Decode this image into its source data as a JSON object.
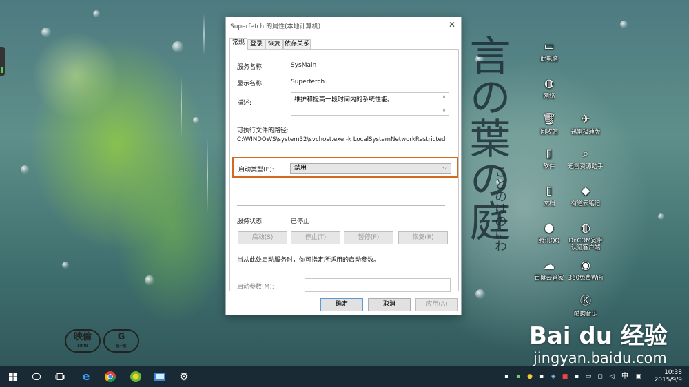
{
  "dialog": {
    "title": "Superfetch 的属性(本地计算机)",
    "close_glyph": "✕",
    "tabs": [
      "常规",
      "登录",
      "恢复",
      "依存关系"
    ],
    "service_name_label": "服务名称:",
    "service_name": "SysMain",
    "display_name_label": "显示名称:",
    "display_name": "Superfetch",
    "description_label": "描述:",
    "description": "维护和提高一段时间内的系统性能。",
    "exe_path_label": "可执行文件的路径:",
    "exe_path": "C:\\WINDOWS\\system32\\svchost.exe -k LocalSystemNetworkRestricted",
    "startup_type_label": "启动类型(E):",
    "startup_type_value": "禁用",
    "service_status_label": "服务状态:",
    "service_status": "已停止",
    "btn_start": "启动(S)",
    "btn_stop": "停止(T)",
    "btn_pause": "暂停(P)",
    "btn_resume": "恢复(R)",
    "hint": "当从此处启动服务时，你可指定所适用的启动参数。",
    "start_params_label": "启动参数(M):",
    "start_params_value": "",
    "btn_ok": "确定",
    "btn_cancel": "取消",
    "btn_apply": "应用(A)",
    "highlight_color": "#d36a1f"
  },
  "desktop_icons": [
    {
      "label": "此电脑",
      "icon": "monitor-icon",
      "glyph": "▭"
    },
    {
      "label": "网络",
      "icon": "globe-icon",
      "glyph": "◍"
    },
    {
      "label": "回收站",
      "icon": "recycle-bin-icon",
      "glyph": "🗑"
    },
    {
      "label": "迅雷极速版",
      "icon": "thunder-bird-icon",
      "glyph": "✈"
    },
    {
      "label": "软件",
      "icon": "file-icon",
      "glyph": "▯"
    },
    {
      "label": "迅雷资源助手",
      "icon": "search-icon",
      "glyph": "⌕"
    },
    {
      "label": "文档",
      "icon": "document-icon",
      "glyph": "▯"
    },
    {
      "label": "有道云笔记",
      "icon": "note-icon",
      "glyph": "◆"
    },
    {
      "label": "腾讯QQ",
      "icon": "qq-icon",
      "glyph": "●"
    },
    {
      "label": "Dr.COM宽带认证客户端",
      "icon": "globe-icon",
      "glyph": "◍"
    },
    {
      "label": "百度云管家",
      "icon": "cloud-icon",
      "glyph": "☁"
    },
    {
      "label": "360免费WiFi",
      "icon": "wifi-icon",
      "glyph": "◉"
    },
    {
      "label": "酷狗音乐",
      "icon": "kugou-icon",
      "glyph": "Ⓚ"
    }
  ],
  "wallpaper": {
    "vertical_text_1": "言の葉の庭",
    "vertical_text_2": "ことのはのにわ",
    "logo_left": "映倫",
    "logo_left_sub": "EIRIN",
    "logo_right": "G",
    "logo_right_sub": "級一般"
  },
  "watermark": {
    "brand": "Bai du 经验",
    "url": "jingyan.baidu.com"
  },
  "taskbar": {
    "start_icon": "windows-start-icon",
    "pinned": [
      "cortana-icon",
      "task-view-icon",
      "edge-icon",
      "chrome-icon",
      "360-browser-icon",
      "app-icon",
      "settings-gear-icon"
    ],
    "ime": "中",
    "time": "10:38",
    "date": "2015/9/9"
  }
}
